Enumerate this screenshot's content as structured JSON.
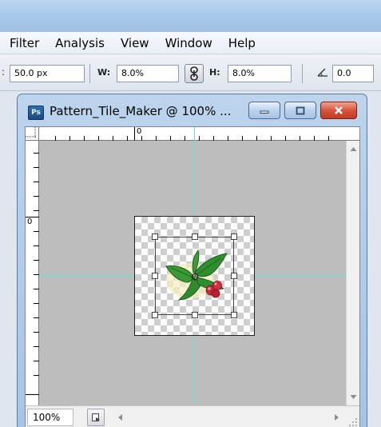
{
  "menu": {
    "items": [
      {
        "label": "Filter"
      },
      {
        "label": "Analysis"
      },
      {
        "label": "View"
      },
      {
        "label": "Window"
      },
      {
        "label": "Help"
      }
    ]
  },
  "options": {
    "lead_value": "50.0 px",
    "w_label": "W:",
    "w_value": "8.0%",
    "h_label": "H:",
    "h_value": "8.0%",
    "angle_value": "0.0"
  },
  "document": {
    "title": "Pattern_Tile_Maker @ 100% ...",
    "app_icon_text": "Ps",
    "ruler_h_zero": "0",
    "ruler_v_zero": "0",
    "zoom": "100%"
  },
  "colors": {
    "guide": "#5fe3e3",
    "close_button": "#c94a33",
    "leaf": "#2f8f2f",
    "berry": "#c9283a"
  },
  "icons": {
    "link": "chain-link-icon",
    "angle": "angle-icon",
    "minimize": "minimize-icon",
    "maximize": "maximize-icon",
    "close": "close-icon"
  }
}
